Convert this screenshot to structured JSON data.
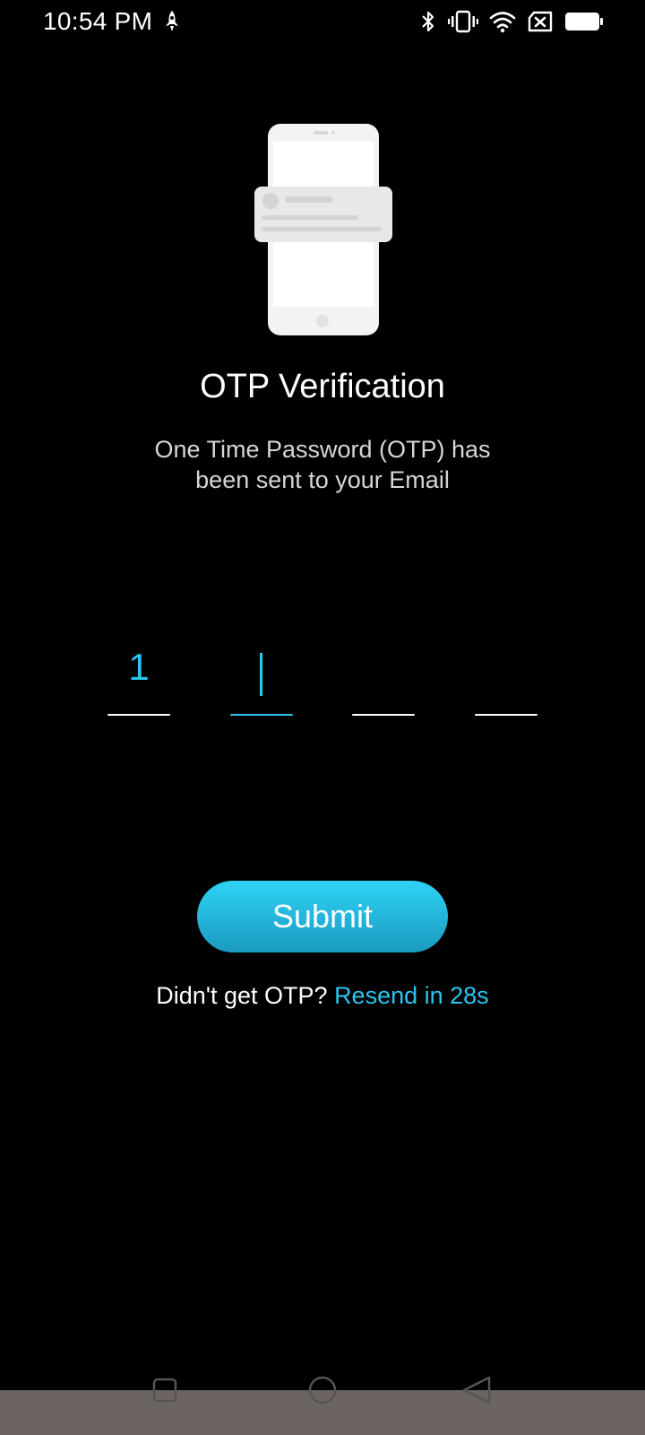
{
  "status_bar": {
    "time": "10:54 PM",
    "icons": [
      "notification-rocket-icon",
      "bluetooth-icon",
      "vibrate-icon",
      "wifi-icon",
      "no-sim-icon",
      "battery-icon"
    ]
  },
  "illustration": {
    "icon": "phone-otp-illustration"
  },
  "title": "OTP Verification",
  "subtitle": "One Time Password (OTP) has been sent to your Email",
  "otp": {
    "digits": [
      "1",
      "",
      "",
      ""
    ],
    "active_index": 1
  },
  "submit_label": "Submit",
  "resend": {
    "prefix": "Didn't get OTP?",
    "link": "Resend in 28s"
  },
  "nav_bar": {
    "buttons": [
      "recent-apps",
      "home",
      "back"
    ]
  },
  "colors": {
    "accent": "#2bc5ef",
    "background": "#000000",
    "nav_bar": "#6b6462"
  }
}
